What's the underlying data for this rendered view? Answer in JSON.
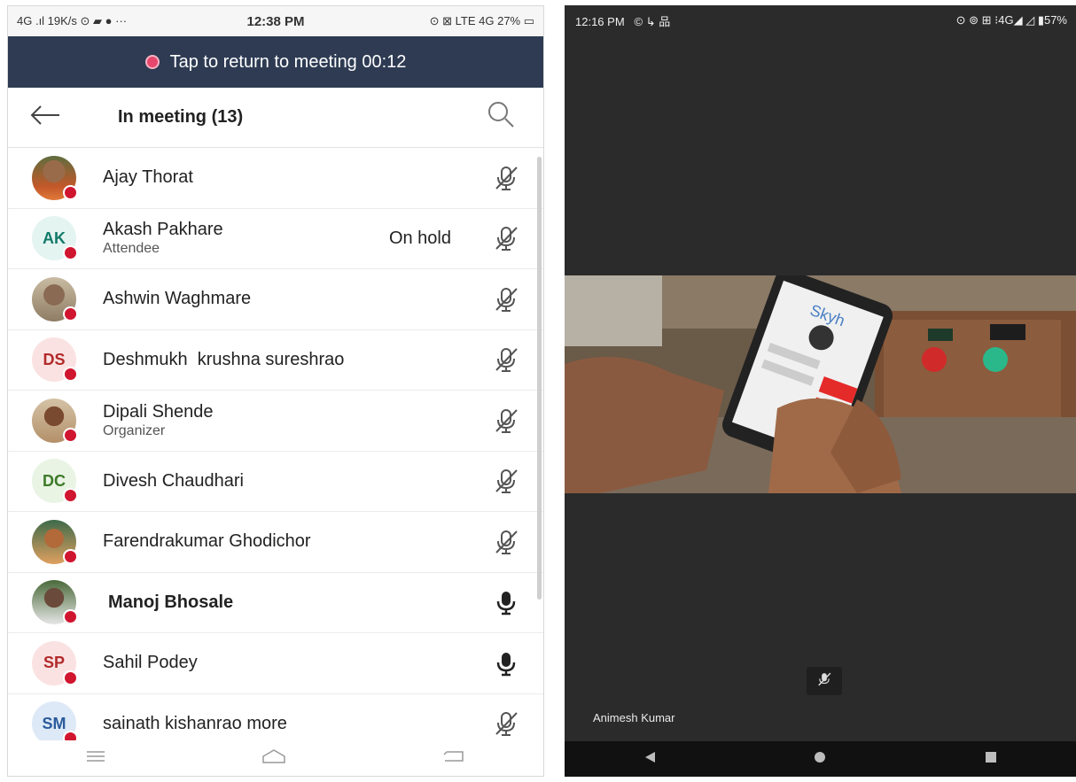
{
  "left_phone": {
    "status_bar": {
      "left": "4G .ıl 19K/s ⊙ ▰ ●  ···",
      "time": "12:38 PM",
      "right": "⊙ ⊠ LTE 4G 27% ▭"
    },
    "banner": {
      "text": "Tap to return to meeting 00:12"
    },
    "header": {
      "title": "In meeting (13)",
      "back_icon": "back-arrow-icon",
      "search_icon": "search-icon"
    },
    "participants": [
      {
        "name": "Ajay Thorat",
        "role": "",
        "initials": "",
        "status": "",
        "mic": "muted"
      },
      {
        "name": "Akash Pakhare",
        "role": "Attendee",
        "initials": "AK",
        "status": "On hold",
        "mic": "muted"
      },
      {
        "name": "Ashwin Waghmare",
        "role": "",
        "initials": "",
        "status": "",
        "mic": "muted"
      },
      {
        "name": "Deshmukh  krushna sureshrao",
        "role": "",
        "initials": "DS",
        "status": "",
        "mic": "muted"
      },
      {
        "name": "Dipali Shende",
        "role": "Organizer",
        "initials": "",
        "status": "",
        "mic": "muted"
      },
      {
        "name": "Divesh Chaudhari",
        "role": "",
        "initials": "DC",
        "status": "",
        "mic": "muted"
      },
      {
        "name": "Farendrakumar Ghodichor",
        "role": "",
        "initials": "",
        "status": "",
        "mic": "muted"
      },
      {
        "name": "Manoj Bhosale",
        "role": "",
        "initials": "",
        "status": "",
        "mic": "unmuted"
      },
      {
        "name": "Sahil Podey",
        "role": "",
        "initials": "SP",
        "status": "",
        "mic": "unmuted"
      },
      {
        "name": "sainath kishanrao more",
        "role": "",
        "initials": "SM",
        "status": "",
        "mic": "muted"
      }
    ],
    "colors": {
      "banner_bg": "#2e3b53",
      "presence_dot": "#d0152f",
      "recording_dot": "#e7476c"
    }
  },
  "right_phone": {
    "status_bar": {
      "time": "12:16 PM",
      "left_icons": "© ↳ 品",
      "right": "⊙ ⊚ ⊞ ⁝4G◢ ◿ ▮57%"
    },
    "video_text": "Skyh",
    "presenter_name": "Animesh Kumar",
    "colors": {
      "background": "#2b2b2b"
    }
  }
}
